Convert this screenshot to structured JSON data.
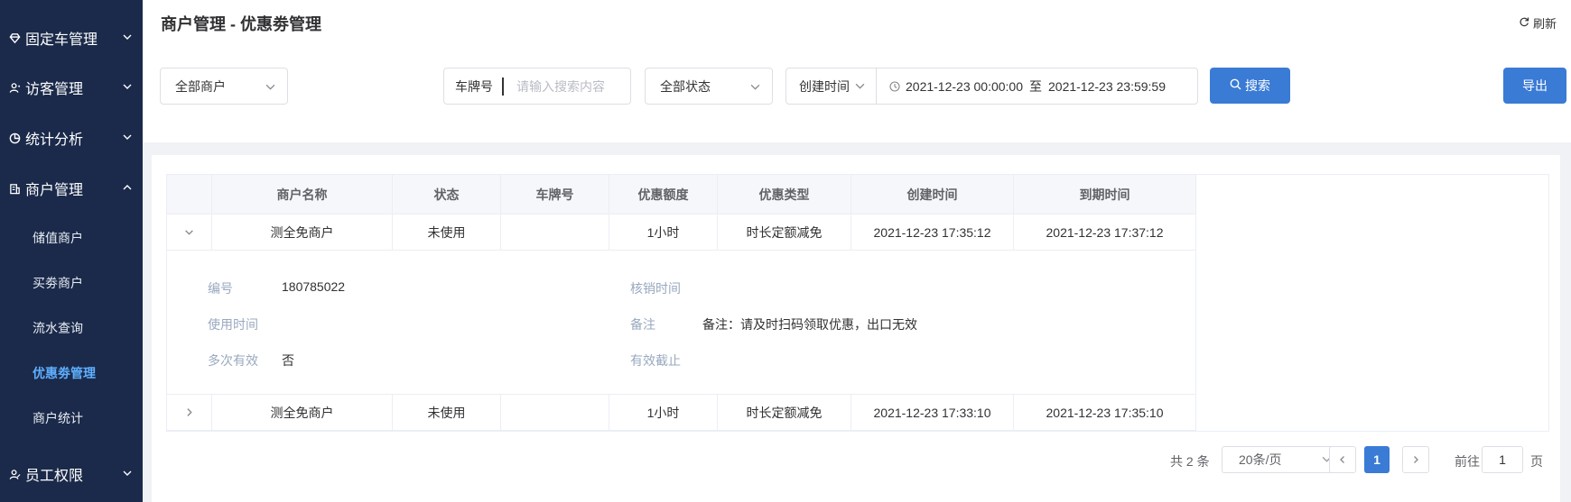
{
  "sidebar": {
    "groups": [
      {
        "label": "固定车管理",
        "icon": "diamond-icon",
        "expanded": false
      },
      {
        "label": "访客管理",
        "icon": "visitor-icon",
        "expanded": false
      },
      {
        "label": "统计分析",
        "icon": "pie-chart-icon",
        "expanded": false
      },
      {
        "label": "商户管理",
        "icon": "building-icon",
        "expanded": true
      },
      {
        "label": "员工权限",
        "icon": "staff-icon",
        "expanded": false
      }
    ],
    "sub_items": [
      {
        "label": "储值商户",
        "active": false
      },
      {
        "label": "买劵商户",
        "active": false
      },
      {
        "label": "流水查询",
        "active": false
      },
      {
        "label": "优惠劵管理",
        "active": true
      },
      {
        "label": "商户统计",
        "active": false
      }
    ]
  },
  "header": {
    "title": "商户管理 - 优惠劵管理",
    "refresh_label": "刷新"
  },
  "filters": {
    "merchant_select": "全部商户",
    "plate_label": "车牌号",
    "plate_placeholder": "请输入搜索内容",
    "status_select": "全部状态",
    "date_type": "创建时间",
    "date_start": "2021-12-23 00:00:00",
    "date_separator": "至",
    "date_end": "2021-12-23 23:59:59",
    "search_label": "搜索",
    "export_label": "导出"
  },
  "table": {
    "columns": [
      "商户名称",
      "状态",
      "车牌号",
      "优惠额度",
      "优惠类型",
      "创建时间",
      "到期时间"
    ],
    "rows": [
      {
        "merchant": "测全免商户",
        "status": "未使用",
        "plate": "",
        "amount": "1小时",
        "type": "时长定额减免",
        "created": "2021-12-23 17:35:12",
        "expires": "2021-12-23 17:37:12",
        "expanded": true
      },
      {
        "merchant": "测全免商户",
        "status": "未使用",
        "plate": "",
        "amount": "1小时",
        "type": "时长定额减免",
        "created": "2021-12-23 17:33:10",
        "expires": "2021-12-23 17:35:10",
        "expanded": false
      }
    ],
    "expand_detail": {
      "id_label": "编号",
      "id_value": "180785022",
      "verify_label": "核销时间",
      "verify_value": "",
      "use_time_label": "使用时间",
      "use_time_value": "",
      "remark_label": "备注",
      "remark_value": "备注：请及时扫码领取优惠，出口无效",
      "multi_label": "多次有效",
      "multi_value": "否",
      "valid_label": "有效截止",
      "valid_value": ""
    }
  },
  "pagination": {
    "total": "共 2 条",
    "page_size": "20条/页",
    "current_page": "1",
    "goto_label": "前往",
    "goto_value": "1",
    "page_suffix": "页"
  },
  "colors": {
    "sidebar_bg": "#1b2a4a",
    "primary": "#3a7bd5",
    "active_sub": "#5fb0ff"
  }
}
